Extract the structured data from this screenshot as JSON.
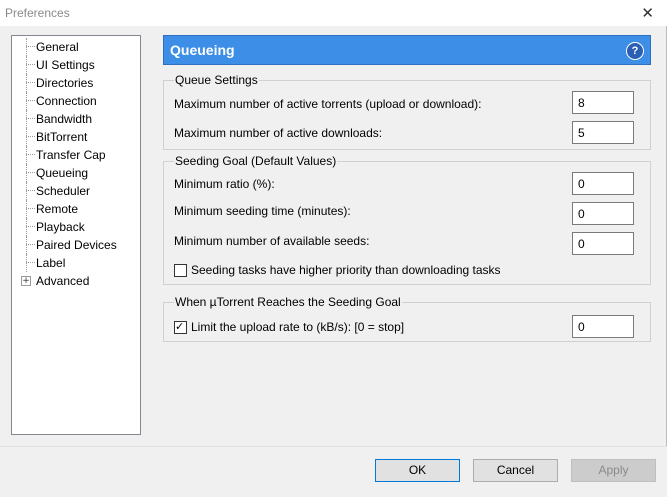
{
  "window": {
    "title": "Preferences",
    "close_glyph": "✕"
  },
  "tree": {
    "items": [
      {
        "label": "General"
      },
      {
        "label": "UI Settings"
      },
      {
        "label": "Directories"
      },
      {
        "label": "Connection"
      },
      {
        "label": "Bandwidth"
      },
      {
        "label": "BitTorrent"
      },
      {
        "label": "Transfer Cap"
      },
      {
        "label": "Queueing",
        "selected": true
      },
      {
        "label": "Scheduler"
      },
      {
        "label": "Remote"
      },
      {
        "label": "Playback"
      },
      {
        "label": "Paired Devices"
      },
      {
        "label": "Label"
      },
      {
        "label": "Advanced",
        "expandable": true
      }
    ],
    "expander_glyph": "+"
  },
  "header": {
    "title": "Queueing",
    "help_glyph": "?"
  },
  "queue_settings": {
    "legend": "Queue Settings",
    "max_active_torrents_label": "Maximum number of active torrents (upload or download):",
    "max_active_torrents_value": "8",
    "max_active_downloads_label": "Maximum number of active downloads:",
    "max_active_downloads_value": "5"
  },
  "seeding_goal": {
    "legend": "Seeding Goal (Default Values)",
    "min_ratio_label": "Minimum ratio (%):",
    "min_ratio_value": "0",
    "min_seed_time_label": "Minimum seeding time (minutes):",
    "min_seed_time_value": "0",
    "min_seeds_label": "Minimum number of available seeds:",
    "min_seeds_value": "0",
    "priority_label": "Seeding tasks have higher priority than downloading tasks",
    "priority_checked": false
  },
  "reach_goal": {
    "legend": "When µTorrent Reaches the Seeding Goal",
    "limit_label": "Limit the upload rate to (kB/s): [0 = stop]",
    "limit_checked": true,
    "limit_value": "0"
  },
  "footer": {
    "ok_label": "OK",
    "cancel_label": "Cancel",
    "apply_label": "Apply"
  }
}
